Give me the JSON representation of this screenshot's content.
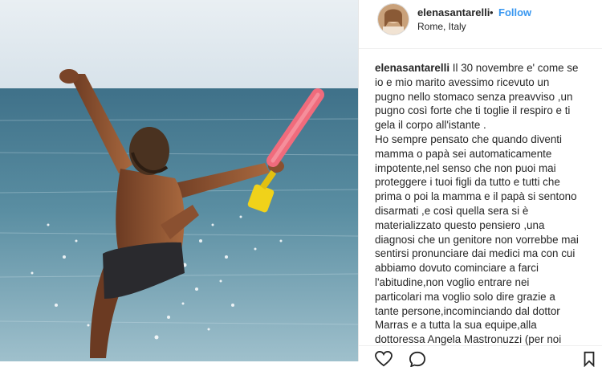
{
  "post": {
    "username": "elenasantarelli",
    "separator": "•",
    "follow_label": "Follow",
    "location": "Rome, Italy"
  },
  "caption": {
    "username": "elenasantarelli",
    "lines": [
      "Il 30 novembre e' come se",
      "io e mio marito avessimo ricevuto un",
      "pugno nello stomaco senza preavviso ,un",
      "pugno così forte che ti toglie il respiro e ti",
      "gela il corpo all'istante .",
      "Ho sempre pensato che quando diventi",
      "mamma o papà sei automaticamente",
      "impotente,nel senso che non puoi mai",
      "proteggere i tuoi figli da tutto e tutti che",
      "prima o poi la mamma e il papà si sentono",
      "disarmati ,e così quella sera si è",
      "materializzato questo pensiero ,una",
      "diagnosi che un genitore non vorrebbe mai",
      "sentirsi pronunciare dai medici ma con cui",
      "abbiamo dovuto cominciare a farci",
      "l'abitudine,non voglio entrare nei",
      "particolari ma voglio solo dire grazie a",
      "tante persone,incominciando dal dottor",
      "Marras e a tutta la sua equipe,alla",
      "dottoressa Angela Mastronuzzi (per noi"
    ]
  },
  "icons": {
    "like": "heart-icon",
    "comment": "comment-icon",
    "save": "bookmark-icon"
  },
  "colors": {
    "link": "#3897f0",
    "text": "#262626",
    "sea": "#4f7f93",
    "sky": "#dfe8ee",
    "noodle": "#f06b7c",
    "handle": "#f0d21a"
  }
}
